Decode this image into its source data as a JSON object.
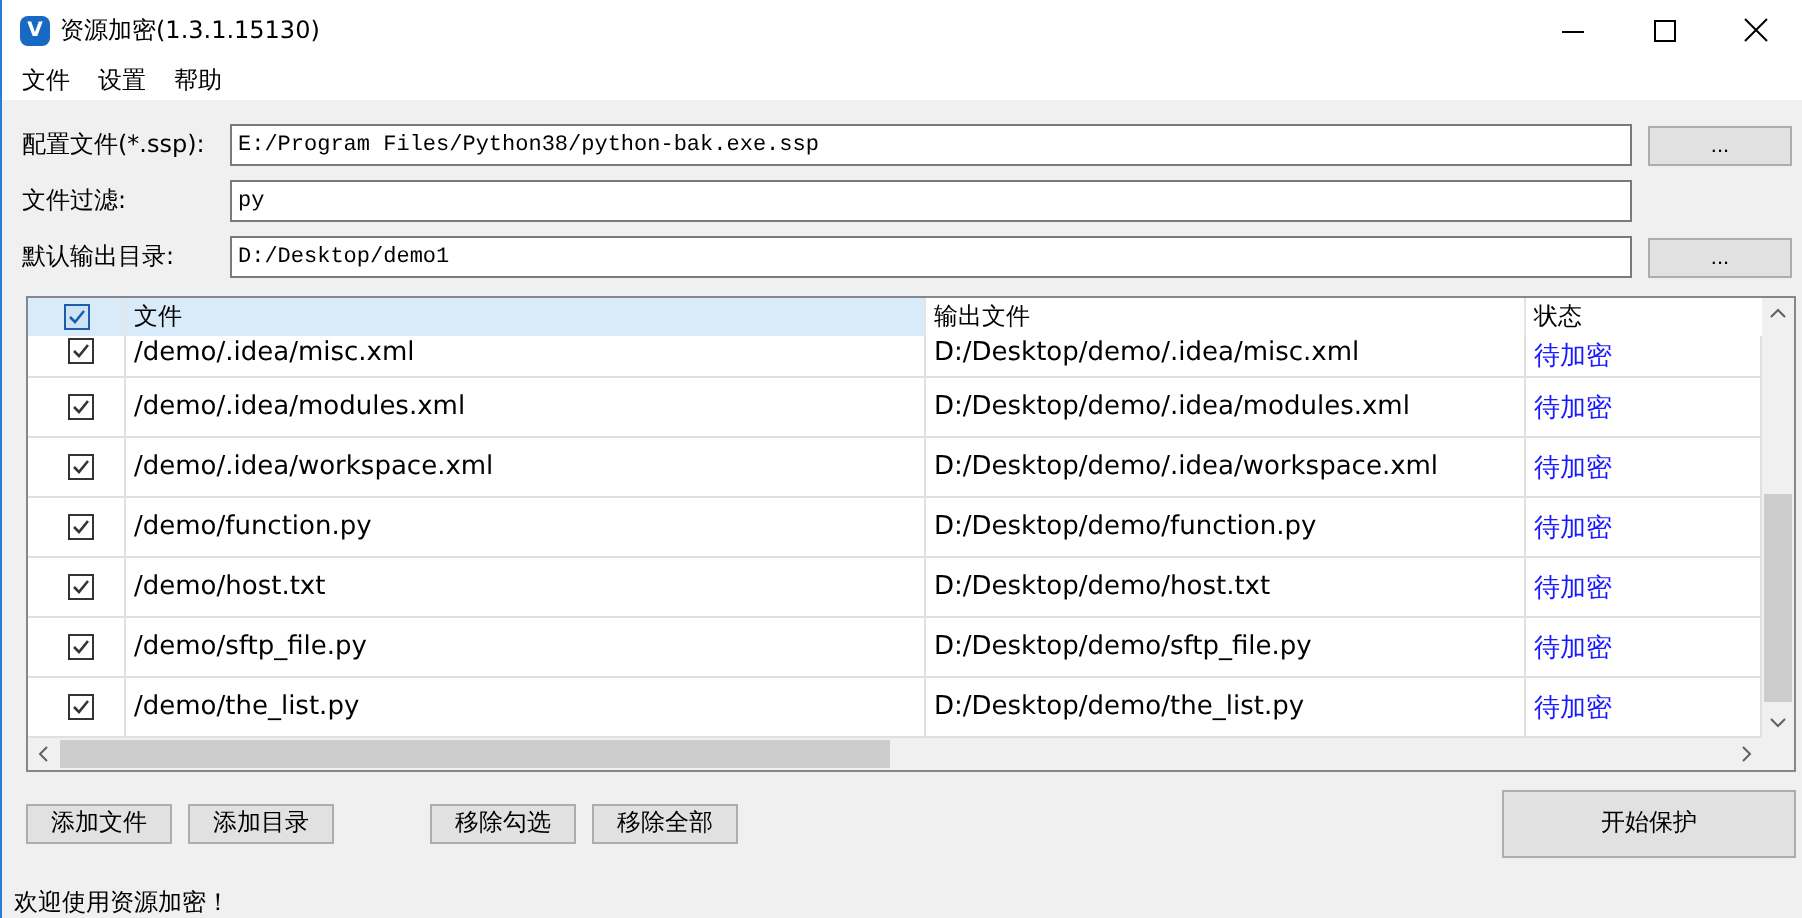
{
  "window": {
    "icon_letter": "V",
    "title": "资源加密(1.3.1.15130)"
  },
  "menu": [
    "文件",
    "设置",
    "帮助"
  ],
  "form": [
    {
      "label": "配置文件(*.ssp):",
      "value": "E:/Program Files/Python38/python-bak.exe.ssp",
      "button": "..."
    },
    {
      "label": "文件过滤:",
      "value": "py"
    },
    {
      "label": "默认输出目录:",
      "value": "D:/Desktop/demo1",
      "button": "..."
    }
  ],
  "table": {
    "select_all": {
      "checked": true
    },
    "columns": [
      {
        "label": "文件",
        "selected": true
      },
      {
        "label": "输出文件",
        "selected": false
      },
      {
        "label": "状态",
        "selected": false
      }
    ],
    "rows": [
      {
        "checked": true,
        "file": "/demo/.idea/misc.xml",
        "output": "D:/Desktop/demo/.idea/misc.xml",
        "status": "待加密"
      },
      {
        "checked": true,
        "file": "/demo/.idea/modules.xml",
        "output": "D:/Desktop/demo/.idea/modules.xml",
        "status": "待加密"
      },
      {
        "checked": true,
        "file": "/demo/.idea/workspace.xml",
        "output": "D:/Desktop/demo/.idea/workspace.xml",
        "status": "待加密"
      },
      {
        "checked": true,
        "file": "/demo/function.py",
        "output": "D:/Desktop/demo/function.py",
        "status": "待加密"
      },
      {
        "checked": true,
        "file": "/demo/host.txt",
        "output": "D:/Desktop/demo/host.txt",
        "status": "待加密"
      },
      {
        "checked": true,
        "file": "/demo/sftp_file.py",
        "output": "D:/Desktop/demo/sftp_file.py",
        "status": "待加密"
      },
      {
        "checked": true,
        "file": "/demo/the_list.py",
        "output": "D:/Desktop/demo/the_list.py",
        "status": "待加密"
      }
    ]
  },
  "buttons": [
    {
      "label": "添加文件",
      "kind": "small"
    },
    {
      "label": "添加目录",
      "kind": "small"
    },
    {
      "label": "移除勾选",
      "kind": "small"
    },
    {
      "label": "移除全部",
      "kind": "small"
    },
    {
      "label": "开始保护",
      "kind": "large"
    }
  ],
  "status_bar": "欢迎使用资源加密！"
}
